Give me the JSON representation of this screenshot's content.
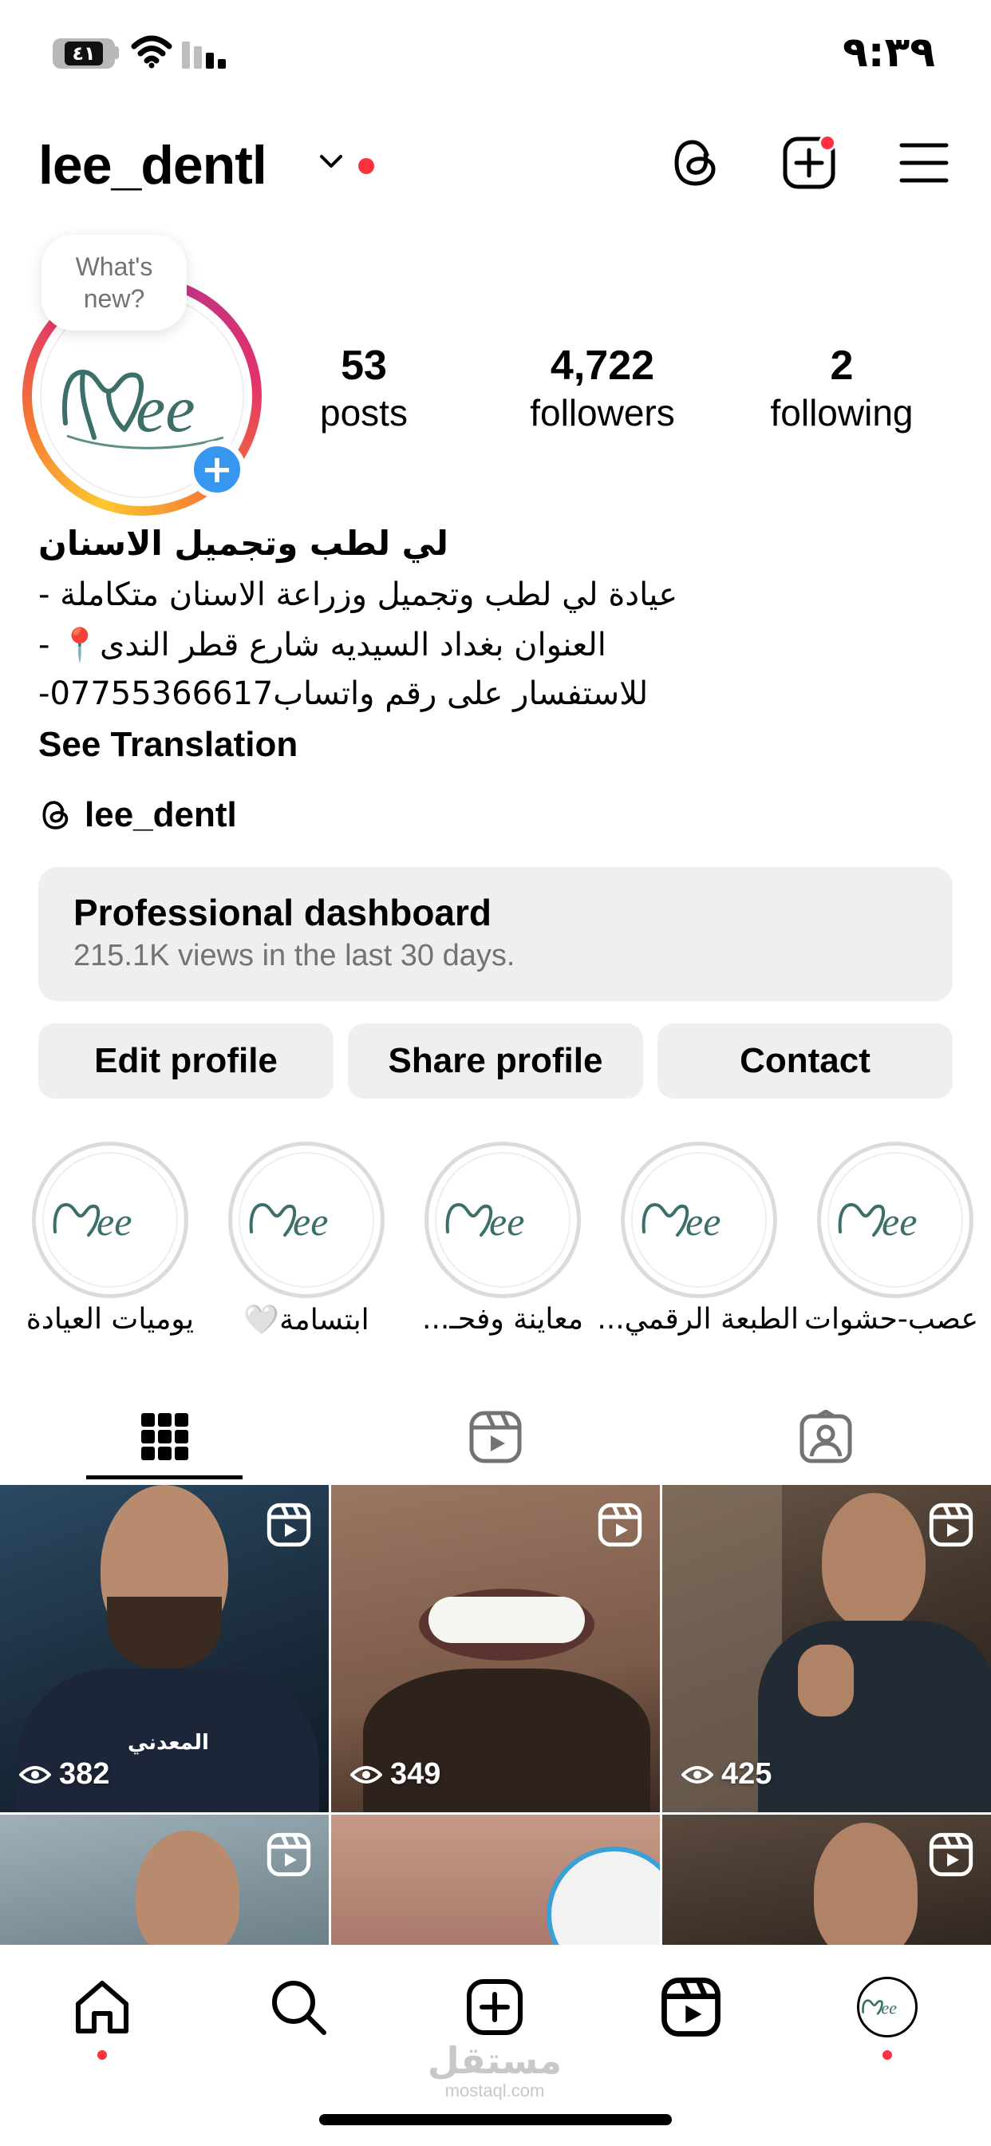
{
  "status_bar": {
    "time": "٩:٣٩",
    "battery": "٤١"
  },
  "header": {
    "username": "lee_dentl"
  },
  "profile": {
    "story_prompt_line1": "What's",
    "story_prompt_line2": "new?",
    "logo_text": "Lee",
    "stats": [
      {
        "value": "53",
        "label": "posts"
      },
      {
        "value": "4,722",
        "label": "followers"
      },
      {
        "value": "2",
        "label": "following"
      }
    ]
  },
  "bio": {
    "name": "لي لطب وتجميل الاسنان",
    "line1": "عيادة لي لطب وتجميل وزراعة الاسنان متكاملة -",
    "line2": "العنوان بغداد السيديه شارع قطر الندى📍 -",
    "line3": "للاستفسار على رقم واتساب07755366617-",
    "see_translation": "See Translation",
    "threads_handle": "lee_dentl"
  },
  "dashboard": {
    "title": "Professional dashboard",
    "subtitle": "215.1K views in the last 30 days."
  },
  "buttons": {
    "edit": "Edit profile",
    "share": "Share profile",
    "contact": "Contact"
  },
  "highlights": [
    {
      "label": "يوميات العيادة"
    },
    {
      "label": "ابتسامة🤍"
    },
    {
      "label": "معاينة وفحـ..."
    },
    {
      "label": "الطبعة الرقمي..."
    },
    {
      "label": "عصب-حشوات"
    }
  ],
  "grid": [
    {
      "views": "382",
      "caption": "المعدني"
    },
    {
      "views": "349"
    },
    {
      "views": "425"
    }
  ],
  "watermark": {
    "arabic": "مستقل",
    "latin": "mostaql.com"
  },
  "colors": {
    "accent_blue": "#3797f0",
    "notification_red": "#ff3040",
    "brand_teal": "#3c6e6a",
    "button_gray": "#efefef"
  }
}
